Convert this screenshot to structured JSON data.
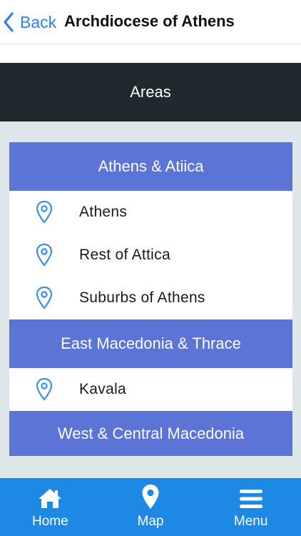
{
  "navbar": {
    "back_label": "Back",
    "title": "Archdiocese of Athens"
  },
  "section_header": "Areas",
  "groups": [
    {
      "title": "Athens & Atiica",
      "items": [
        {
          "label": "Athens",
          "icon": "map-pin-icon"
        },
        {
          "label": "Rest of Attica",
          "icon": "map-pin-icon"
        },
        {
          "label": "Suburbs of Athens",
          "icon": "map-pin-icon"
        }
      ]
    },
    {
      "title": "East Macedonia & Thrace",
      "items": [
        {
          "label": "Kavala",
          "icon": "map-pin-icon"
        }
      ]
    },
    {
      "title": "West & Central Macedonia",
      "items": []
    }
  ],
  "tabbar": {
    "tabs": [
      {
        "label": "Home",
        "icon": "home-icon"
      },
      {
        "label": "Map",
        "icon": "map-marker-icon"
      },
      {
        "label": "Menu",
        "icon": "hamburger-menu-icon"
      }
    ]
  },
  "colors": {
    "accent": "#2f7cf6",
    "header_band": "#1f2a2f",
    "group_header": "#5b74d6",
    "content_bg": "#dfe6e9",
    "tabbar": "#1e88e5"
  }
}
